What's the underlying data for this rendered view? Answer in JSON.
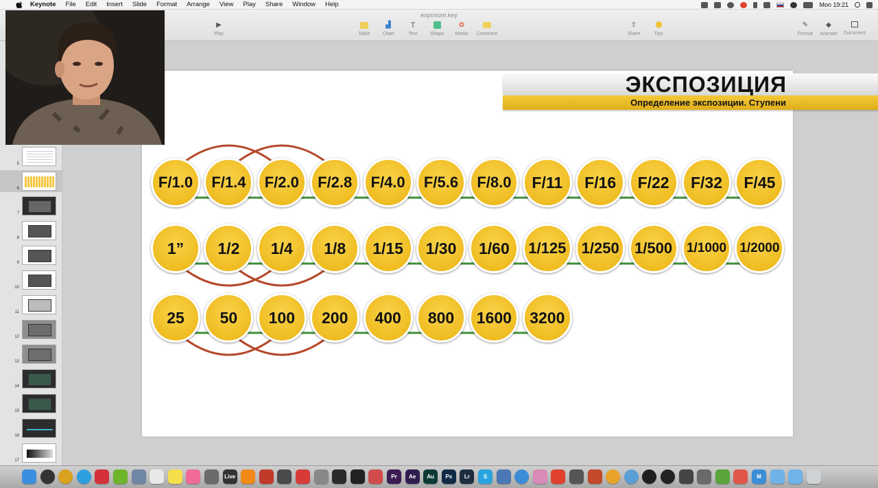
{
  "menubar": {
    "app": "Keynote",
    "items": [
      "File",
      "Edit",
      "Insert",
      "Slide",
      "Format",
      "Arrange",
      "View",
      "Play",
      "Share",
      "Window",
      "Help"
    ],
    "clock": "Mon 19:21"
  },
  "toolbar": {
    "doc_title": "exposure.key",
    "play": "Play",
    "table": "Table",
    "chart": "Chart",
    "text": "Text",
    "shape": "Shape",
    "media": "Media",
    "comment": "Comment",
    "share": "Share",
    "tips": "Tips",
    "format": "Format",
    "animate": "Animate",
    "document": "Document"
  },
  "navigator": {
    "thumbs": [
      {
        "num": "5",
        "style": "lines"
      },
      {
        "num": "6",
        "style": "dots",
        "selected": true
      },
      {
        "num": "7",
        "style": "camera"
      },
      {
        "num": "8",
        "style": "screen"
      },
      {
        "num": "9",
        "style": "screen"
      },
      {
        "num": "10",
        "style": "screen"
      },
      {
        "num": "11",
        "style": "screen-light"
      },
      {
        "num": "12",
        "style": "gray"
      },
      {
        "num": "13",
        "style": "gray"
      },
      {
        "num": "14",
        "style": "photo"
      },
      {
        "num": "15",
        "style": "photo"
      },
      {
        "num": "16",
        "style": "dark"
      },
      {
        "num": "17",
        "style": "bars"
      }
    ]
  },
  "slide": {
    "title": "ЭКСПОЗИЦИЯ",
    "subtitle": "Определение экспозиции. Ступени",
    "apertures": [
      "F/1.0",
      "F/1.4",
      "F/2.0",
      "F/2.8",
      "F/4.0",
      "F/5.6",
      "F/8.0",
      "F/11",
      "F/16",
      "F/22",
      "F/32",
      "F/45"
    ],
    "shutter_speeds": [
      "1”",
      "1/2",
      "1/4",
      "1/8",
      "1/15",
      "1/30",
      "1/60",
      "1/125",
      "1/250",
      "1/500",
      "1/1000",
      "1/2000"
    ],
    "iso": [
      "25",
      "50",
      "100",
      "200",
      "400",
      "800",
      "1600",
      "3200"
    ],
    "colors": {
      "circle": "#f2c232",
      "arc": "#b5482a",
      "link": "#3f8f3a"
    }
  },
  "dock": {
    "icons": [
      {
        "name": "finder-icon",
        "color": "#3c8fe0"
      },
      {
        "name": "launchpad-icon",
        "color": "#333333"
      },
      {
        "name": "chrome-icon",
        "color": "#d9a11d"
      },
      {
        "name": "telegram-icon",
        "color": "#2d9fe0"
      },
      {
        "name": "lips-icon",
        "color": "#d4323a"
      },
      {
        "name": "utorrent-icon",
        "color": "#6fb52c"
      },
      {
        "name": "preview-icon",
        "color": "#6f86a6"
      },
      {
        "name": "textedit-icon",
        "color": "#e8e8e8"
      },
      {
        "name": "stickies-icon",
        "color": "#f5df4d"
      },
      {
        "name": "itunes-icon",
        "color": "#f06b9a"
      },
      {
        "name": "notes-icon",
        "color": "#6a6a6a"
      },
      {
        "name": "live-icon",
        "color": "#333333",
        "label": "Live"
      },
      {
        "name": "vlc-icon",
        "color": "#f28a1a"
      },
      {
        "name": "photo-booth-icon",
        "color": "#c23a2a"
      },
      {
        "name": "gamepad-icon",
        "color": "#4a4a4a"
      },
      {
        "name": "pixelmator-icon",
        "color": "#d83a3a"
      },
      {
        "name": "disk-utility-icon",
        "color": "#888888"
      },
      {
        "name": "activity-icon",
        "color": "#2b2b2b"
      },
      {
        "name": "terminal-icon",
        "color": "#222222"
      },
      {
        "name": "davinci-icon",
        "color": "#d24b4b"
      },
      {
        "name": "premiere-icon",
        "color": "#3b1b52",
        "label": "Pr"
      },
      {
        "name": "after-effects-icon",
        "color": "#2f1e4f",
        "label": "Ae"
      },
      {
        "name": "audition-icon",
        "color": "#0c3b37",
        "label": "Au"
      },
      {
        "name": "photoshop-icon",
        "color": "#0e2a44",
        "label": "Ps"
      },
      {
        "name": "lightroom-icon",
        "color": "#1d2d3e",
        "label": "Lr"
      },
      {
        "name": "skype-icon",
        "color": "#2aa4e0",
        "label": "S"
      },
      {
        "name": "maps-icon",
        "color": "#4c78b5"
      },
      {
        "name": "safari-icon",
        "color": "#3c8dd8"
      },
      {
        "name": "flower-icon",
        "color": "#d98ab6"
      },
      {
        "name": "avast-icon",
        "color": "#e0422e"
      },
      {
        "name": "scanner-icon",
        "color": "#555555"
      },
      {
        "name": "app-3d-icon",
        "color": "#c24a2a"
      },
      {
        "name": "sun-icon",
        "color": "#e8a32a"
      },
      {
        "name": "info-icon",
        "color": "#5b9fd6"
      },
      {
        "name": "camera-icon",
        "color": "#1f1f1f"
      },
      {
        "name": "github-icon",
        "color": "#222222"
      },
      {
        "name": "final-cut-icon",
        "color": "#444444"
      },
      {
        "name": "clapper-icon",
        "color": "#6a6a6a"
      },
      {
        "name": "evernote-icon",
        "color": "#5aa43a"
      },
      {
        "name": "sketch-icon",
        "color": "#e0574a"
      },
      {
        "name": "mail-icon",
        "color": "#3b8fd6",
        "label": "M"
      },
      {
        "name": "folder-icon",
        "color": "#6fb3e8"
      },
      {
        "name": "downloads-icon",
        "color": "#6fb3e8"
      },
      {
        "name": "trash-icon",
        "color": "#cfd3d6"
      }
    ]
  }
}
